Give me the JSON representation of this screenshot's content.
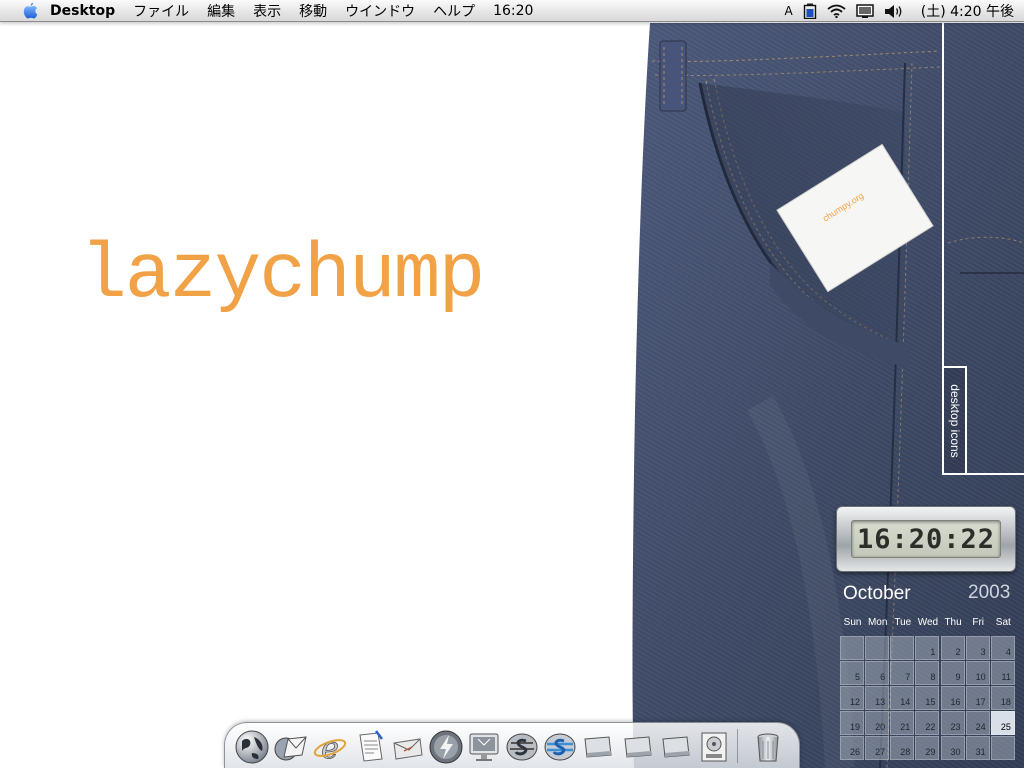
{
  "menubar": {
    "app_name": "Desktop",
    "menus": [
      "ファイル",
      "編集",
      "表示",
      "移動",
      "ウインドウ",
      "ヘルプ"
    ],
    "clock_text": "16:20",
    "input_indicator": "A",
    "datetime": "(土) 4:20 午後"
  },
  "desktop": {
    "brand_text": "lazychump",
    "card_text": "chumpy.org",
    "icon_panel_label": "desktop icons"
  },
  "lcd_clock": {
    "time": "16:20:22"
  },
  "calendar": {
    "month": "October",
    "year": "2003",
    "weekdays": [
      "Sun",
      "Mon",
      "Tue",
      "Wed",
      "Thu",
      "Fri",
      "Sat"
    ],
    "weeks": [
      [
        "",
        "",
        "",
        "1",
        "2",
        "3",
        "4"
      ],
      [
        "5",
        "6",
        "7",
        "8",
        "9",
        "10",
        "11"
      ],
      [
        "12",
        "13",
        "14",
        "15",
        "16",
        "17",
        "18"
      ],
      [
        "19",
        "20",
        "21",
        "22",
        "23",
        "24",
        "25"
      ],
      [
        "26",
        "27",
        "28",
        "29",
        "30",
        "31",
        ""
      ]
    ],
    "today": "25"
  },
  "dock": {
    "items": [
      {
        "icon": "finder-globe-icon"
      },
      {
        "icon": "mail-icon"
      },
      {
        "icon": "internet-explorer-icon"
      },
      {
        "icon": "textedit-icon"
      },
      {
        "icon": "mail-envelope-icon"
      },
      {
        "icon": "quicktime-icon"
      },
      {
        "icon": "system-preferences-icon"
      },
      {
        "icon": "sherlock-icon"
      },
      {
        "icon": "sherlock-blue-icon"
      },
      {
        "icon": "hard-drive-icon"
      },
      {
        "icon": "hard-drive-2-icon"
      },
      {
        "icon": "hard-drive-3-icon"
      },
      {
        "icon": "dvd-player-icon"
      },
      {
        "icon": "trash-icon"
      }
    ]
  },
  "colors": {
    "brand": "#f1a247",
    "denim": "#3e4a63"
  }
}
